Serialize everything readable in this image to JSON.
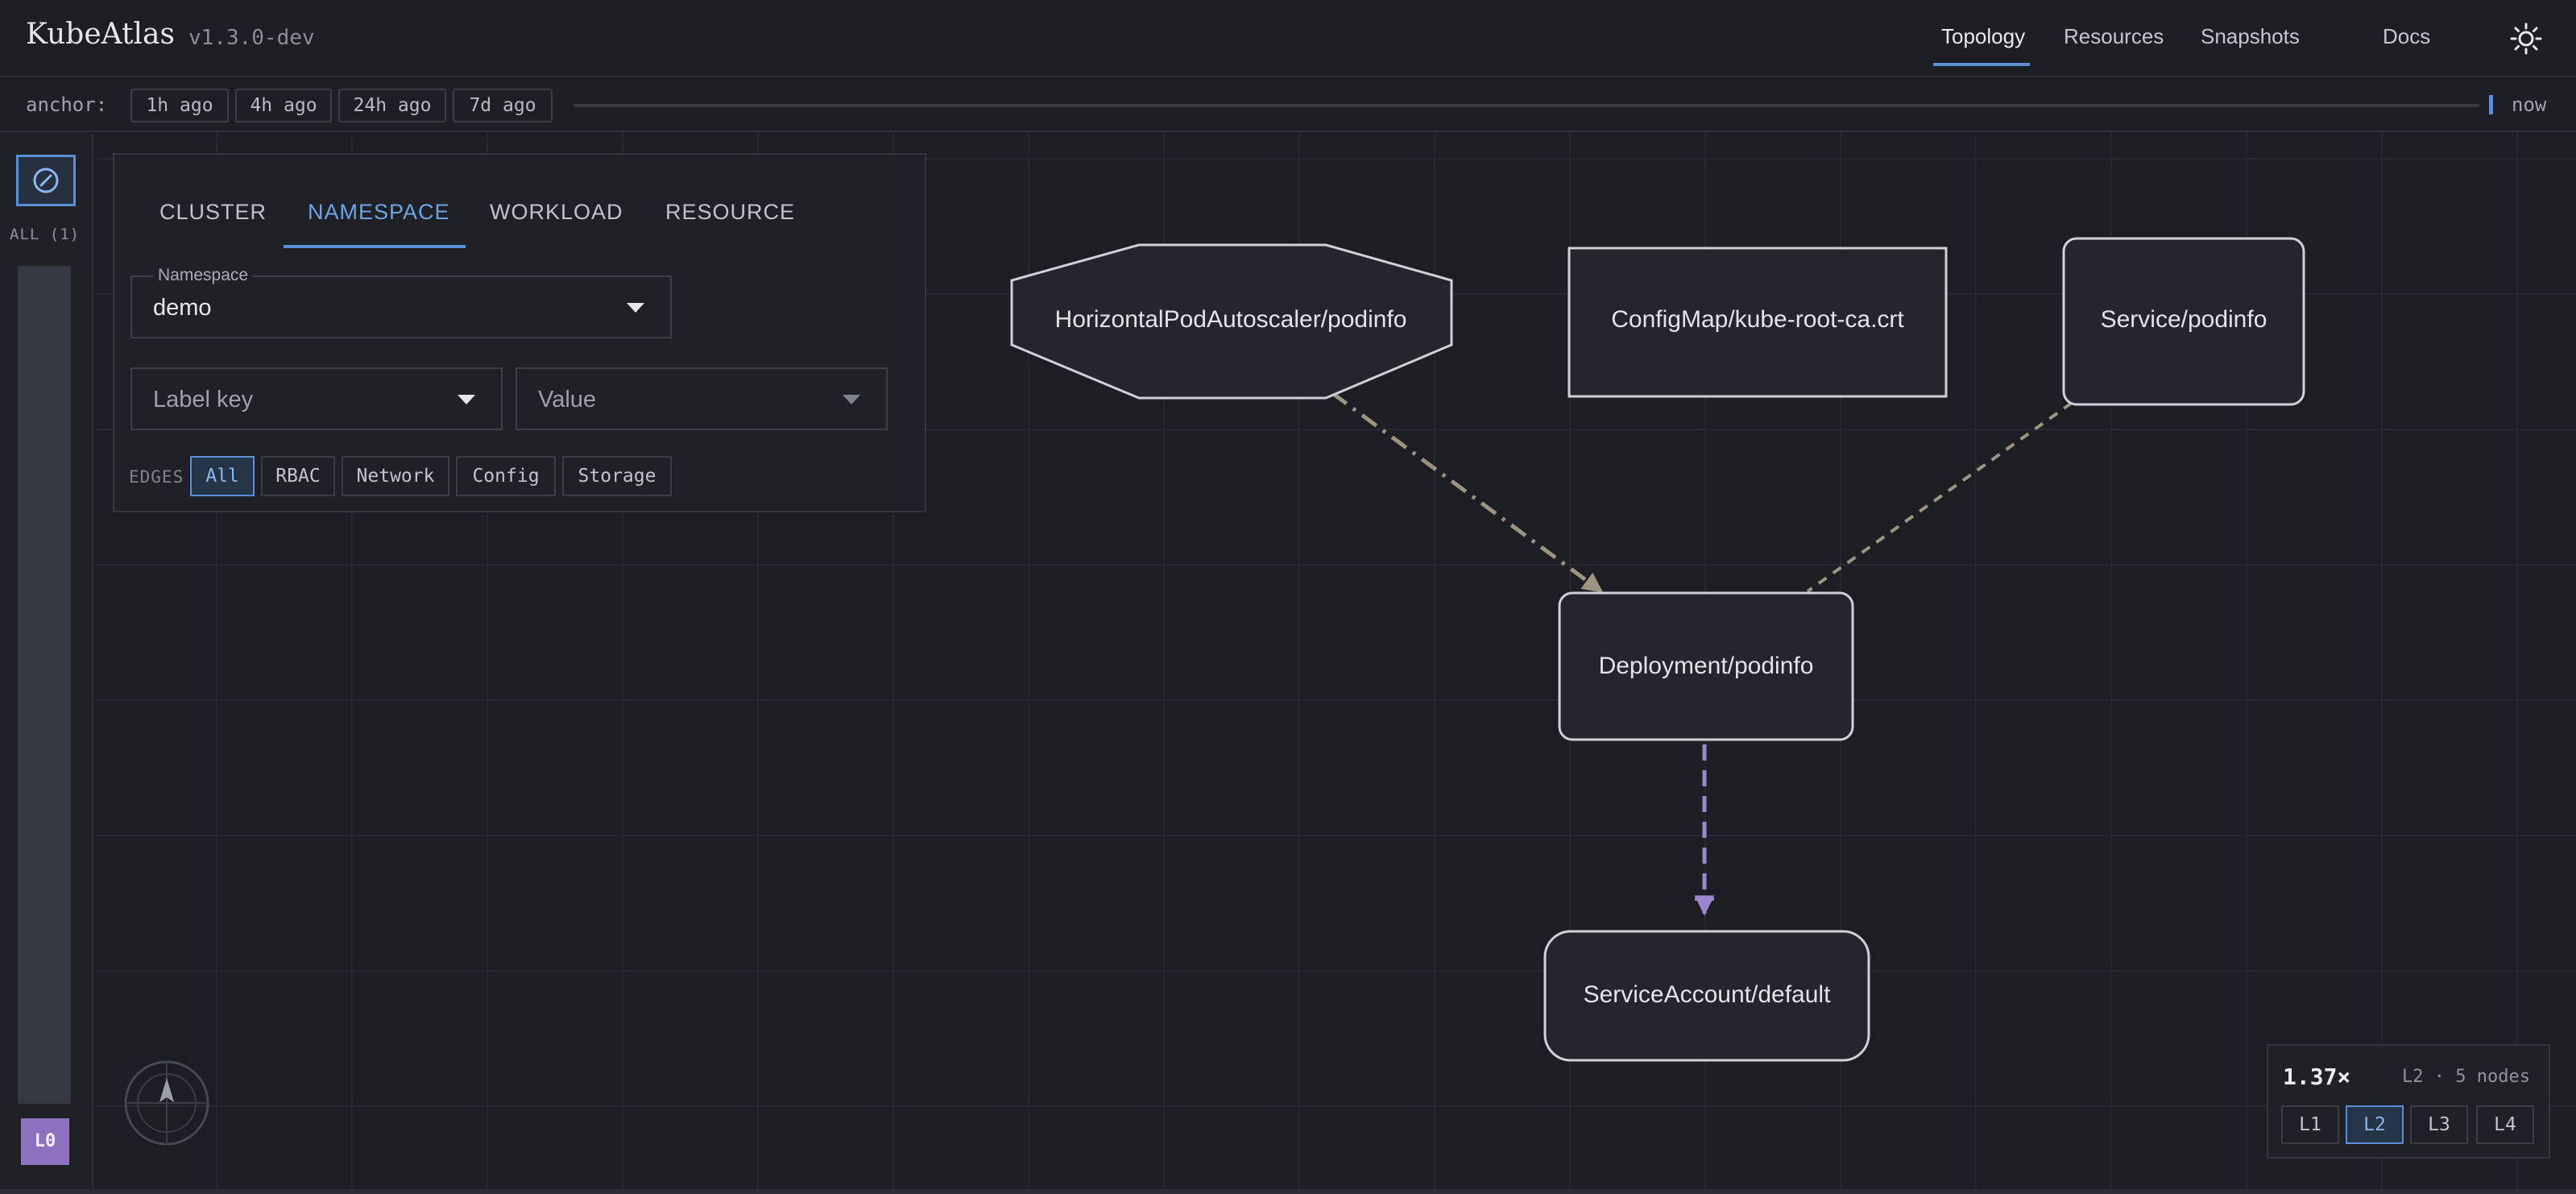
{
  "app": {
    "name": "KubeAtlas",
    "version": "v1.3.0-dev"
  },
  "nav": [
    {
      "label": "Topology",
      "active": true
    },
    {
      "label": "Resources",
      "active": false
    },
    {
      "label": "Snapshots",
      "active": false
    },
    {
      "label": "Docs",
      "active": false
    }
  ],
  "theme_toggle_icon": "sun-icon",
  "timebar": {
    "anchor_label": "anchor:",
    "chips": [
      "1h ago",
      "4h ago",
      "24h ago",
      "7d ago"
    ],
    "end_label": "now",
    "position": 1.0
  },
  "rail": {
    "mode_icon": "compass-icon",
    "all_count": "ALL (1)",
    "level_badge": "L0"
  },
  "filter": {
    "tabs": [
      {
        "label": "CLUSTER",
        "active": false
      },
      {
        "label": "NAMESPACE",
        "active": true
      },
      {
        "label": "WORKLOAD",
        "active": false
      },
      {
        "label": "RESOURCE",
        "active": false
      }
    ],
    "namespace_label": "Namespace",
    "namespace_value": "demo",
    "label_key_placeholder": "Label key",
    "value_placeholder": "Value",
    "edges_label": "EDGES",
    "edge_chips": [
      {
        "label": "All",
        "active": true
      },
      {
        "label": "RBAC",
        "active": false
      },
      {
        "label": "Network",
        "active": false
      },
      {
        "label": "Config",
        "active": false
      },
      {
        "label": "Storage",
        "active": false
      }
    ]
  },
  "graph": {
    "nodes": [
      {
        "id": "hpa",
        "label": "HorizontalPodAutoscaler/podinfo",
        "shape": "octagon"
      },
      {
        "id": "cm",
        "label": "ConfigMap/kube-root-ca.crt",
        "shape": "rect"
      },
      {
        "id": "svc",
        "label": "Service/podinfo",
        "shape": "rounded"
      },
      {
        "id": "deploy",
        "label": "Deployment/podinfo",
        "shape": "rounded"
      },
      {
        "id": "sa",
        "label": "ServiceAccount/default",
        "shape": "rounded"
      }
    ],
    "edges": [
      {
        "from": "hpa",
        "to": "deploy",
        "style": "dash-dot",
        "color": "#9c9381"
      },
      {
        "from": "svc",
        "to": "deploy",
        "style": "dashed",
        "color": "#9c9381"
      },
      {
        "from": "deploy",
        "to": "sa",
        "style": "dashed",
        "color": "#9b86cf"
      }
    ]
  },
  "zoom": {
    "level": "1.37×",
    "info": "L2 · 5 nodes",
    "levels": [
      {
        "label": "L1",
        "active": false
      },
      {
        "label": "L2",
        "active": true
      },
      {
        "label": "L3",
        "active": false
      },
      {
        "label": "L4",
        "active": false
      }
    ]
  },
  "colors": {
    "accent": "#5b8fd6",
    "level_badge": "#8e72c2"
  }
}
